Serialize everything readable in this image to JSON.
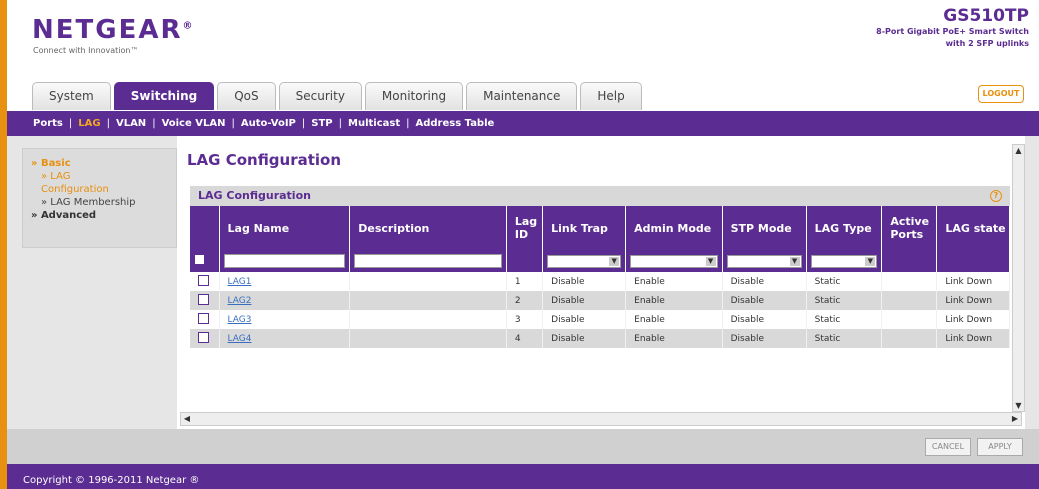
{
  "header": {
    "logo": "NETGEAR",
    "tagline": "Connect with Innovation™",
    "model": "GS510TP",
    "model_desc_line1": "8-Port Gigabit PoE+ Smart Switch",
    "model_desc_line2": "with 2 SFP uplinks",
    "logout": "LOGOUT"
  },
  "tabs": [
    {
      "label": "System"
    },
    {
      "label": "Switching"
    },
    {
      "label": "QoS"
    },
    {
      "label": "Security"
    },
    {
      "label": "Monitoring"
    },
    {
      "label": "Maintenance"
    },
    {
      "label": "Help"
    }
  ],
  "subnav": [
    "Ports",
    "LAG",
    "VLAN",
    "Voice VLAN",
    "Auto-VoIP",
    "STP",
    "Multicast",
    "Address Table"
  ],
  "sidebar": {
    "basic": "» Basic",
    "lag_config_1": "» LAG",
    "lag_config_2": "Configuration",
    "lag_membership": "» LAG Membership",
    "advanced": "» Advanced"
  },
  "page": {
    "title": "LAG Configuration",
    "panel_title": "LAG Configuration"
  },
  "table": {
    "headers": [
      "Lag Name",
      "Description",
      "Lag ID",
      "Link Trap",
      "Admin Mode",
      "STP Mode",
      "LAG Type",
      "Active Ports",
      "LAG state"
    ],
    "rows": [
      {
        "name": "LAG1",
        "desc": "",
        "id": "1",
        "trap": "Disable",
        "admin": "Enable",
        "stp": "Disable",
        "type": "Static",
        "active": "",
        "state": "Link Down"
      },
      {
        "name": "LAG2",
        "desc": "",
        "id": "2",
        "trap": "Disable",
        "admin": "Enable",
        "stp": "Disable",
        "type": "Static",
        "active": "",
        "state": "Link Down"
      },
      {
        "name": "LAG3",
        "desc": "",
        "id": "3",
        "trap": "Disable",
        "admin": "Enable",
        "stp": "Disable",
        "type": "Static",
        "active": "",
        "state": "Link Down"
      },
      {
        "name": "LAG4",
        "desc": "",
        "id": "4",
        "trap": "Disable",
        "admin": "Enable",
        "stp": "Disable",
        "type": "Static",
        "active": "",
        "state": "Link Down"
      }
    ]
  },
  "buttons": {
    "cancel": "CANCEL",
    "apply": "APPLY"
  },
  "footer": "Copyright © 1996-2011 Netgear ®",
  "colors": {
    "brand_purple": "#5b2c91",
    "accent_orange": "#e8900f"
  }
}
